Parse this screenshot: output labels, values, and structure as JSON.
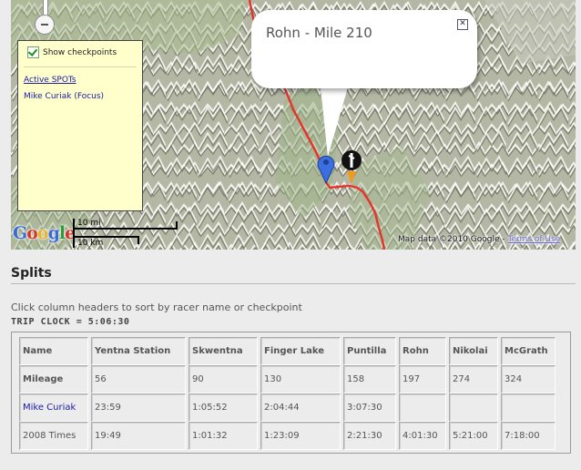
{
  "map": {
    "show_checkpoints_label": "Show checkpoints",
    "active_spots_label": "Active SPOTs",
    "racer_label": "Mike Curiak (Focus)",
    "logo_text": "Google",
    "logo_colors": [
      "#3a6ad6",
      "#d6322a",
      "#e8b428",
      "#3a6ad6",
      "#2f9a3a",
      "#d6322a"
    ],
    "scale_top": "10 mi",
    "scale_bottom": "10 km",
    "map_data": "Map data ©2010 Google -",
    "terms_of_use": "Terms of Use",
    "popup_title": "Rohn - Mile 210",
    "popup_close": "✕",
    "route_color": "#e8332a",
    "marker_colors": {
      "checkpoint": "#3b6fe0",
      "racer": "#111111",
      "racer_accent": "#f39a1c"
    }
  },
  "splits": {
    "title": "Splits",
    "instructions": "Click column headers to sort by racer name or checkpoint",
    "trip_clock": "TRIP CLOCK = 5:06:30",
    "headers": [
      "Name",
      "Yentna Station",
      "Skwentna",
      "Finger Lake",
      "Puntilla",
      "Rohn",
      "Nikolai",
      "McGrath"
    ],
    "rows": [
      {
        "label": "Mileage",
        "cells": [
          "56",
          "90",
          "130",
          "158",
          "197",
          "274",
          "324"
        ]
      },
      {
        "label": "Mike Curiak",
        "cells": [
          "23:59",
          "1:05:52",
          "2:04:44",
          "3:07:30",
          "",
          "",
          ""
        ]
      },
      {
        "label": "2008 Times",
        "cells": [
          "19:49",
          "1:01:32",
          "1:23:09",
          "2:21:30",
          "4:01:30",
          "5:21:00",
          "7:18:00"
        ]
      }
    ]
  }
}
